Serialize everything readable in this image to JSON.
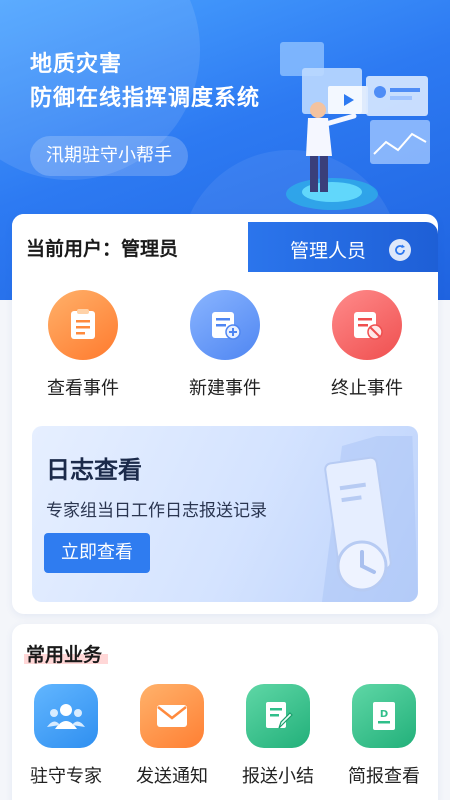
{
  "hero": {
    "title_line1": "地质灾害",
    "title_line2": "防御在线指挥调度系统",
    "pill": "汛期驻守小帮手"
  },
  "user": {
    "label": "当前用户：管理员",
    "role": "管理人员",
    "refresh_icon": "refresh-icon"
  },
  "actions": [
    {
      "label": "查看事件",
      "icon": "document-icon",
      "color": "#ff8a3d"
    },
    {
      "label": "新建事件",
      "icon": "add-document-icon",
      "color": "#4f8df6"
    },
    {
      "label": "终止事件",
      "icon": "cancel-document-icon",
      "color": "#f35a5a"
    }
  ],
  "log": {
    "title": "日志查看",
    "subtitle": "专家组当日工作日志报送记录",
    "button": "立即查看"
  },
  "business": {
    "title": "常用业务",
    "items": [
      {
        "label": "驻守专家",
        "icon": "group-icon",
        "color": "#3d9bf5"
      },
      {
        "label": "发送通知",
        "icon": "mail-icon",
        "color": "#ff8a3d"
      },
      {
        "label": "报送小结",
        "icon": "edit-document-icon",
        "color": "#2fbf8a"
      },
      {
        "label": "简报查看",
        "icon": "report-icon",
        "color": "#2fbf8a"
      }
    ]
  }
}
